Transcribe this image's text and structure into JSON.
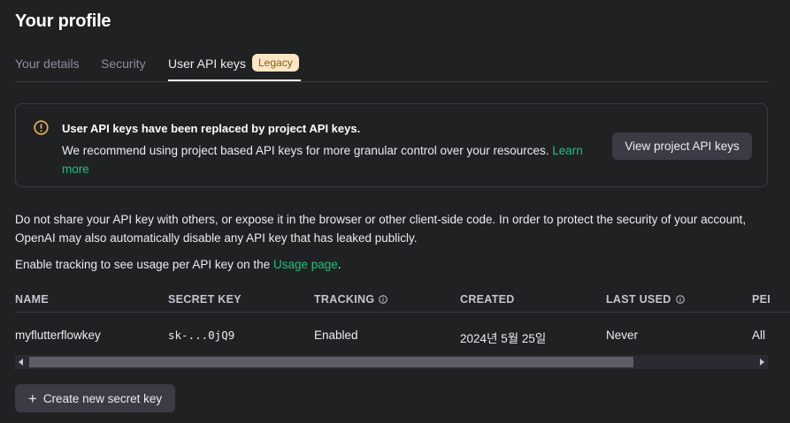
{
  "page": {
    "title": "Your profile"
  },
  "tabs": [
    {
      "label": "Your details"
    },
    {
      "label": "Security"
    },
    {
      "label": "User API keys",
      "badge": "Legacy"
    }
  ],
  "banner": {
    "title": "User API keys have been replaced by project API keys.",
    "text": "We recommend using project based API keys for more granular control over your resources.",
    "link": "Learn more",
    "button": "View project API keys"
  },
  "warning": {
    "line1": "Do not share your API key with others, or expose it in the browser or other client-side code. In order to protect the security of your account,",
    "line2": "OpenAI may also automatically disable any API key that has leaked publicly."
  },
  "tracking": {
    "text": "Enable tracking to see usage per API key on the",
    "link": "Usage page",
    "suffix": "."
  },
  "table": {
    "headers": [
      "NAME",
      "SECRET KEY",
      "TRACKING",
      "CREATED",
      "LAST USED",
      "PEI"
    ],
    "row": {
      "name": "myflutterflowkey",
      "secret": "sk-...0jQ9",
      "tracking": "Enabled",
      "created": "2024년 5월 25일",
      "last_used": "Never",
      "permissions": "All"
    }
  },
  "create_button": {
    "plus": "+",
    "label": "Create new secret key"
  }
}
